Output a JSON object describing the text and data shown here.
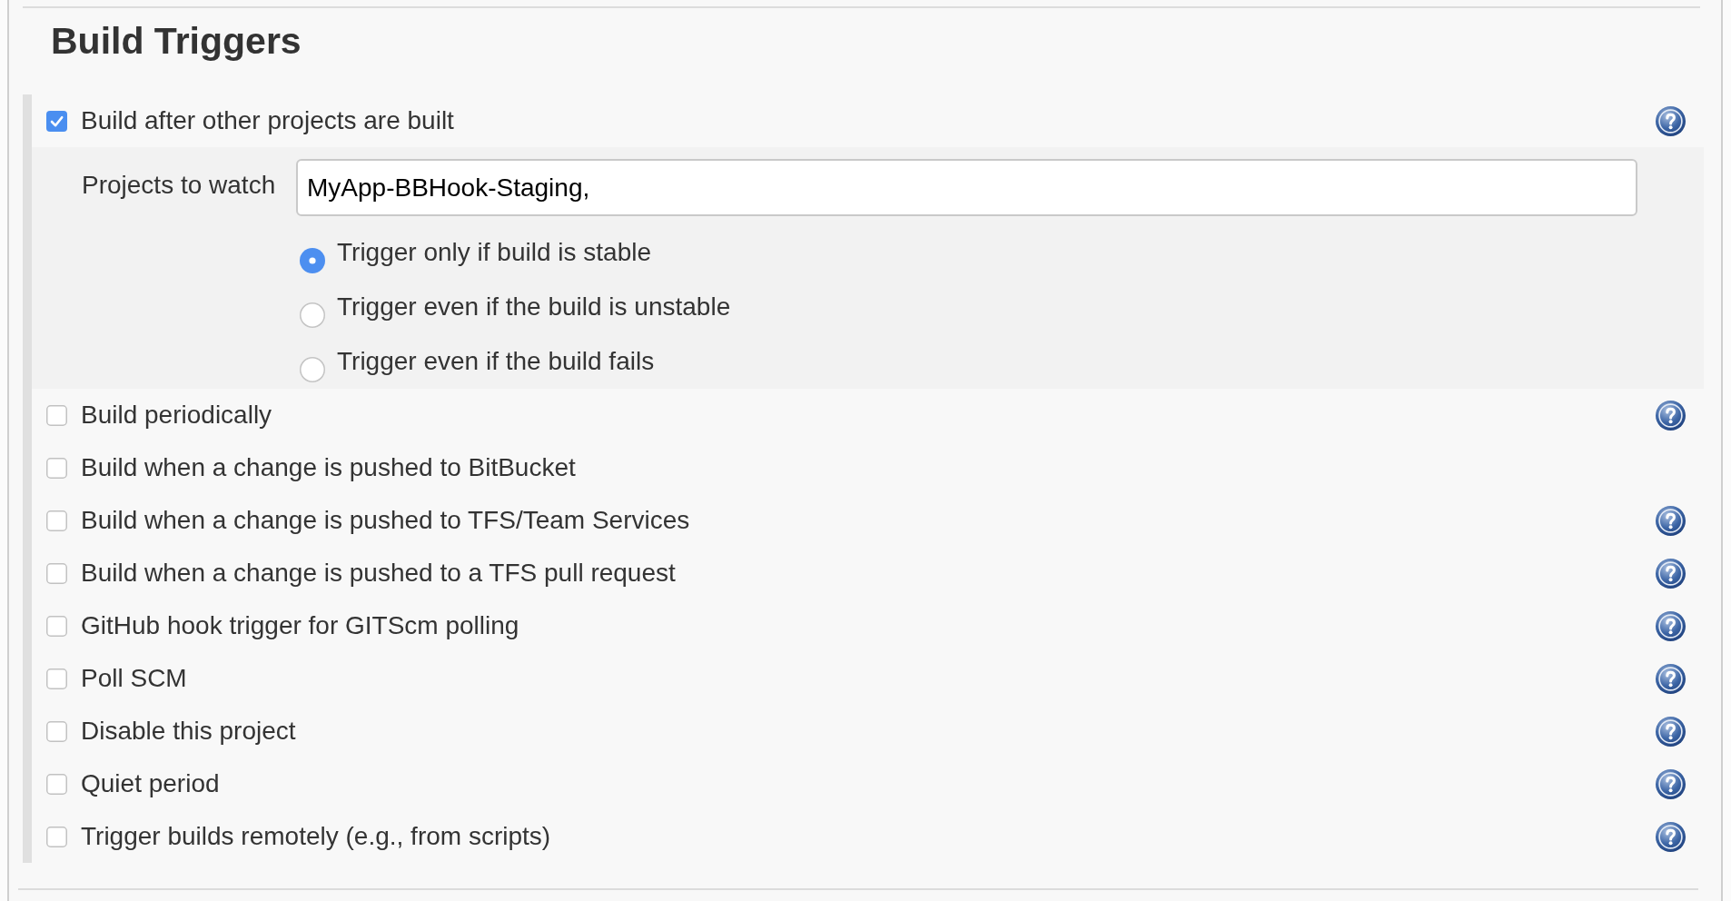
{
  "section": {
    "title": "Build Triggers"
  },
  "triggers": [
    {
      "label": "Build after other projects are built",
      "checked": true,
      "help": true,
      "options": {
        "projects_to_watch": {
          "label": "Projects to watch",
          "value": "MyApp-BBHook-Staging,"
        },
        "conditions": [
          {
            "label": "Trigger only if build is stable",
            "selected": true
          },
          {
            "label": "Trigger even if the build is unstable",
            "selected": false
          },
          {
            "label": "Trigger even if the build fails",
            "selected": false
          }
        ]
      }
    },
    {
      "label": "Build periodically",
      "checked": false,
      "help": true
    },
    {
      "label": "Build when a change is pushed to BitBucket",
      "checked": false,
      "help": false
    },
    {
      "label": "Build when a change is pushed to TFS/Team Services",
      "checked": false,
      "help": true
    },
    {
      "label": "Build when a change is pushed to a TFS pull request",
      "checked": false,
      "help": true
    },
    {
      "label": "GitHub hook trigger for GITScm polling",
      "checked": false,
      "help": true
    },
    {
      "label": "Poll SCM",
      "checked": false,
      "help": true
    },
    {
      "label": "Disable this project",
      "checked": false,
      "help": true
    },
    {
      "label": "Quiet period",
      "checked": false,
      "help": true
    },
    {
      "label": "Trigger builds remotely (e.g., from scripts)",
      "checked": false,
      "help": true
    }
  ]
}
